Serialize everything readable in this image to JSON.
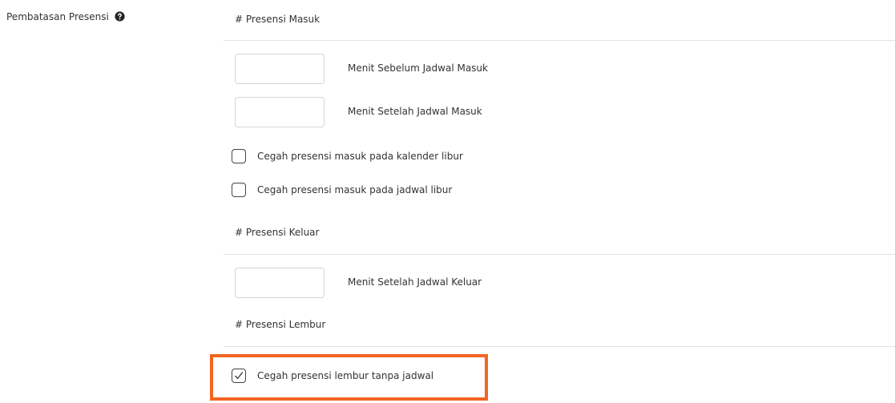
{
  "field": {
    "label": "Pembatasan Presensi",
    "help_icon": "question-circle-icon"
  },
  "masuk": {
    "title": "# Presensi Masuk",
    "before_input": {
      "value": "",
      "caption": "Menit Sebelum Jadwal Masuk"
    },
    "after_input": {
      "value": "",
      "caption": "Menit Setelah Jadwal Masuk"
    },
    "checks": [
      {
        "label": "Cegah presensi masuk pada kalender libur",
        "checked": false
      },
      {
        "label": "Cegah presensi masuk pada jadwal libur",
        "checked": false
      }
    ]
  },
  "keluar": {
    "title": "# Presensi Keluar",
    "after_input": {
      "value": "",
      "caption": "Menit Setelah Jadwal Keluar"
    }
  },
  "lembur": {
    "title": "# Presensi Lembur",
    "check": {
      "label": "Cegah presensi lembur tanpa jadwal",
      "checked": true
    }
  },
  "colors": {
    "highlight": "#f26522",
    "divider": "#e4e4e4",
    "text": "#333333"
  }
}
